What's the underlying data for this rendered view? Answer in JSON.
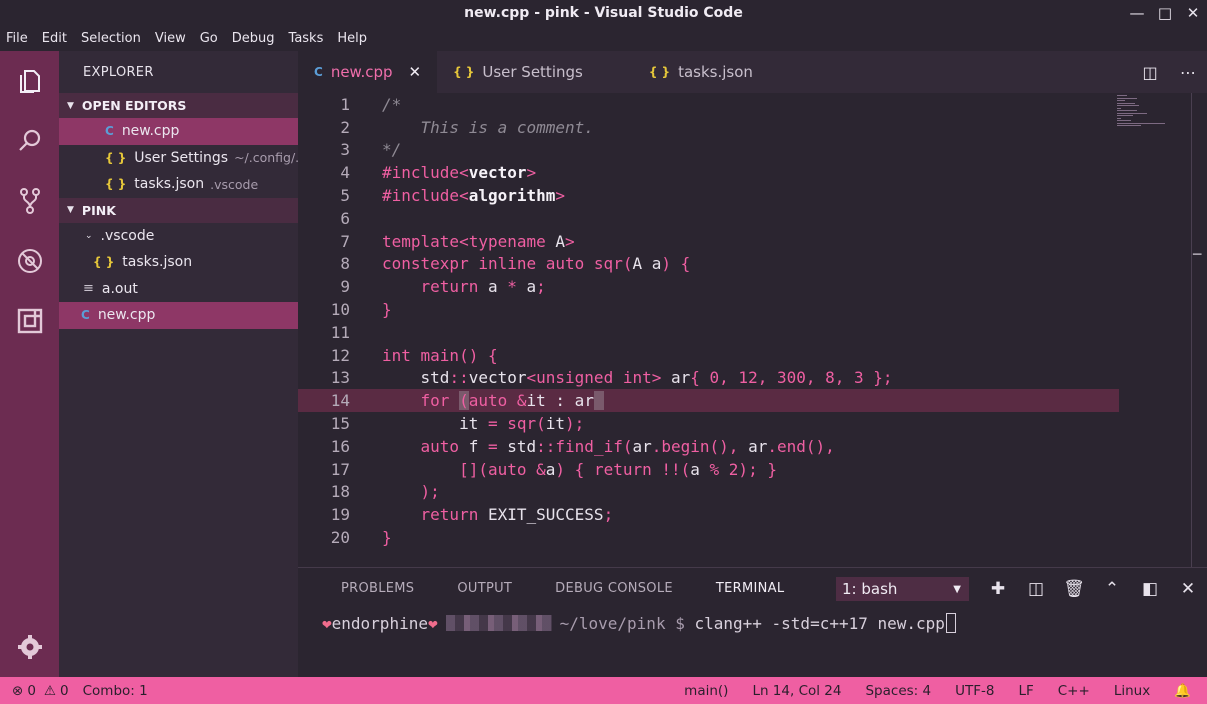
{
  "window": {
    "title": "new.cpp - pink - Visual Studio Code"
  },
  "menu": [
    "File",
    "Edit",
    "Selection",
    "View",
    "Go",
    "Debug",
    "Tasks",
    "Help"
  ],
  "sidebar": {
    "header": "EXPLORER",
    "open_editors_title": "OPEN EDITORS",
    "open_editors": [
      {
        "name": "new.cpp",
        "desc": ""
      },
      {
        "name": "User Settings",
        "desc": "~/.config/..."
      },
      {
        "name": "tasks.json",
        "desc": ".vscode"
      }
    ],
    "project_title": "PINK",
    "tree": [
      {
        "name": ".vscode"
      },
      {
        "name": "tasks.json"
      },
      {
        "name": "a.out"
      },
      {
        "name": "new.cpp"
      }
    ]
  },
  "tabs": [
    {
      "label": "new.cpp"
    },
    {
      "label": "User Settings"
    },
    {
      "label": "tasks.json"
    }
  ],
  "editor": {
    "line_numbers": [
      "1",
      "2",
      "3",
      "4",
      "5",
      "6",
      "7",
      "8",
      "9",
      "10",
      "11",
      "12",
      "13",
      "14",
      "15",
      "16",
      "17",
      "18",
      "19",
      "20"
    ],
    "cursor_line": 14
  },
  "panel": {
    "tabs": [
      "PROBLEMS",
      "OUTPUT",
      "DEBUG CONSOLE",
      "TERMINAL"
    ],
    "terminal_select": "1: bash",
    "prompt_user": "endorphine",
    "prompt_path": "~/love/pink $ ",
    "command": "clang++ -std=c++17 new.cpp"
  },
  "status": {
    "errors": "0",
    "warnings": "0",
    "combo": "Combo: 1",
    "scope": "main()",
    "position": "Ln 14, Col 24",
    "spaces": "Spaces: 4",
    "encoding": "UTF-8",
    "eol": "LF",
    "language": "C++",
    "os": "Linux"
  },
  "colors": {
    "accent": "#ef5fa2",
    "activity_bar": "#6c2c51",
    "active_row": "#8e3766"
  }
}
